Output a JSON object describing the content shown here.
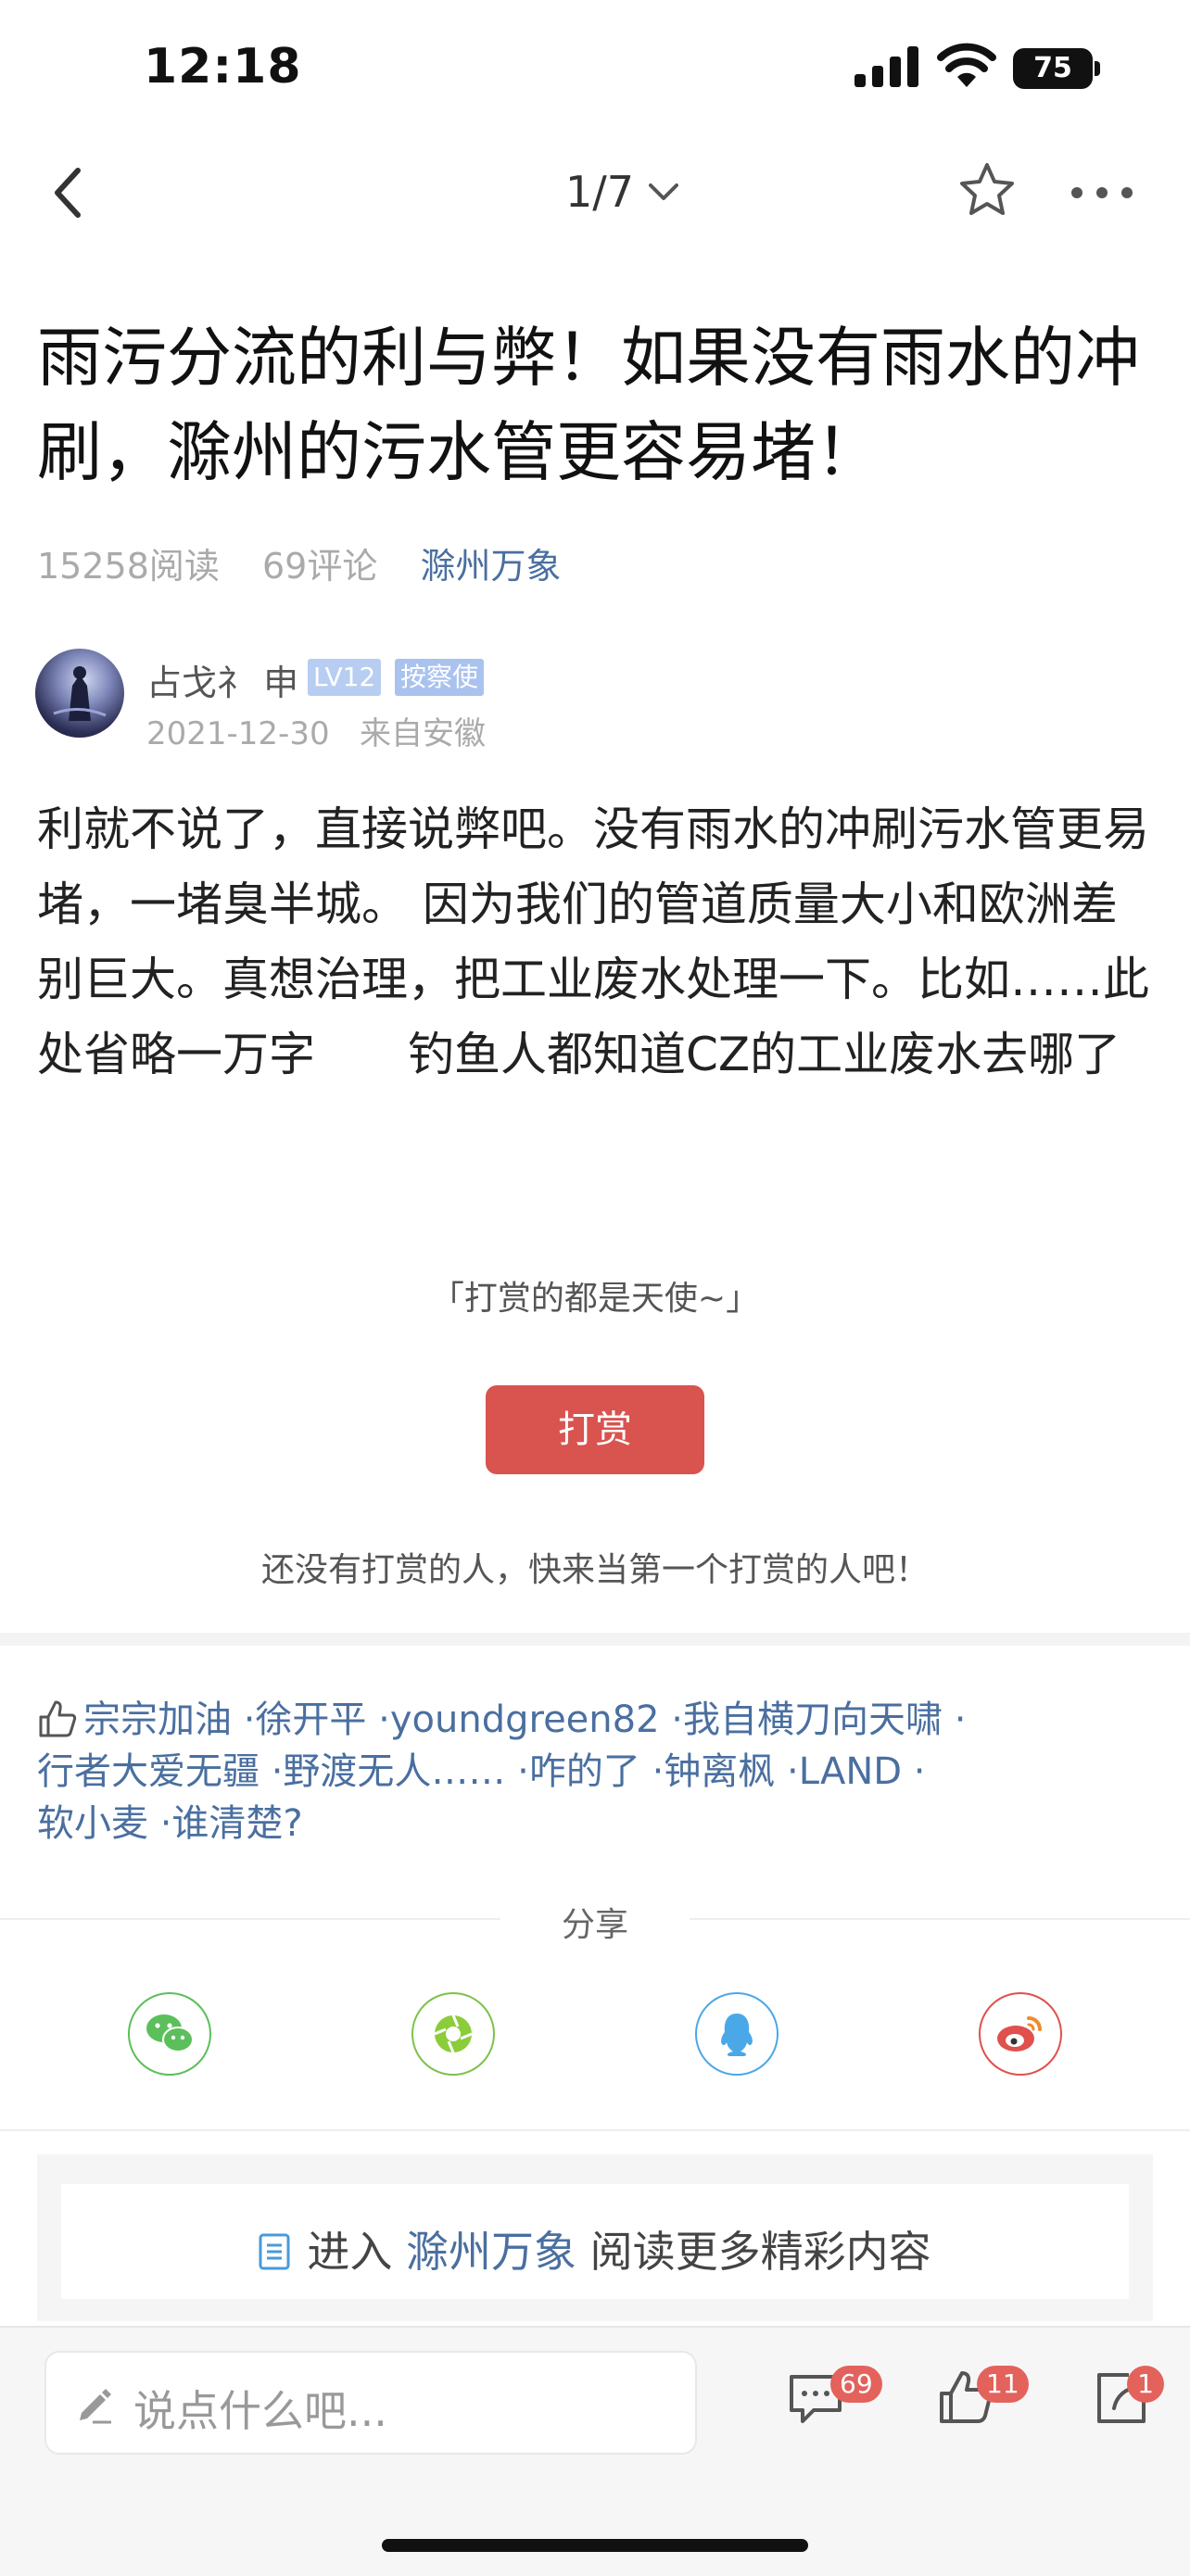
{
  "status_bar": {
    "time": "12:18",
    "battery": "75"
  },
  "nav": {
    "page_indicator": "1/7"
  },
  "post": {
    "title": "雨污分流的利与弊！如果没有雨水的冲刷，滁州的污水管更容易堵！",
    "reads": "15258阅读",
    "comments": "69评论",
    "category": "滁州万象",
    "author": {
      "name": "占戈礻 申",
      "level": "LV12",
      "role": "按察使",
      "date": "2021-12-30",
      "location": "来自安徽"
    },
    "body": "利就不说了，直接说弊吧。没有雨水的冲刷污水管更易堵，一堵臭半城。 因为我们的管道质量大小和欧洲差别巨大。真想治理，把工业废水处理一下。比如……此处省略一万字　　钓鱼人都知道CZ的工业废水去哪了"
  },
  "reward": {
    "slogan": "「打赏的都是天使~」",
    "button_label": "打赏",
    "empty_text": "还没有打赏的人，快来当第一个打赏的人吧！"
  },
  "likers": [
    "宗宗加油",
    "·徐开平",
    "·youndgreen82",
    "·我自横刀向天啸",
    "·",
    "行者大爱无疆",
    "·野渡无人……",
    "·咋的了",
    "·钟离枫",
    "·LAND",
    "·",
    "软小麦",
    "·谁清楚?"
  ],
  "share": {
    "label": "分享",
    "buttons": [
      {
        "name": "wechat",
        "color": "#5bbf5b"
      },
      {
        "name": "moments",
        "color": "#7cc24a"
      },
      {
        "name": "qq",
        "color": "#4aa8e8"
      },
      {
        "name": "weibo",
        "color": "#e0504c"
      }
    ]
  },
  "enter": {
    "prefix": "进入",
    "category": "滁州万象",
    "suffix": "阅读更多精彩内容"
  },
  "bottom_bar": {
    "placeholder": "说点什么吧...",
    "comment_count": "69",
    "like_count": "11",
    "share_count": "1"
  },
  "colors": {
    "link": "#4a6fa0",
    "reward": "#d9534f",
    "badge": "#e4625c"
  }
}
